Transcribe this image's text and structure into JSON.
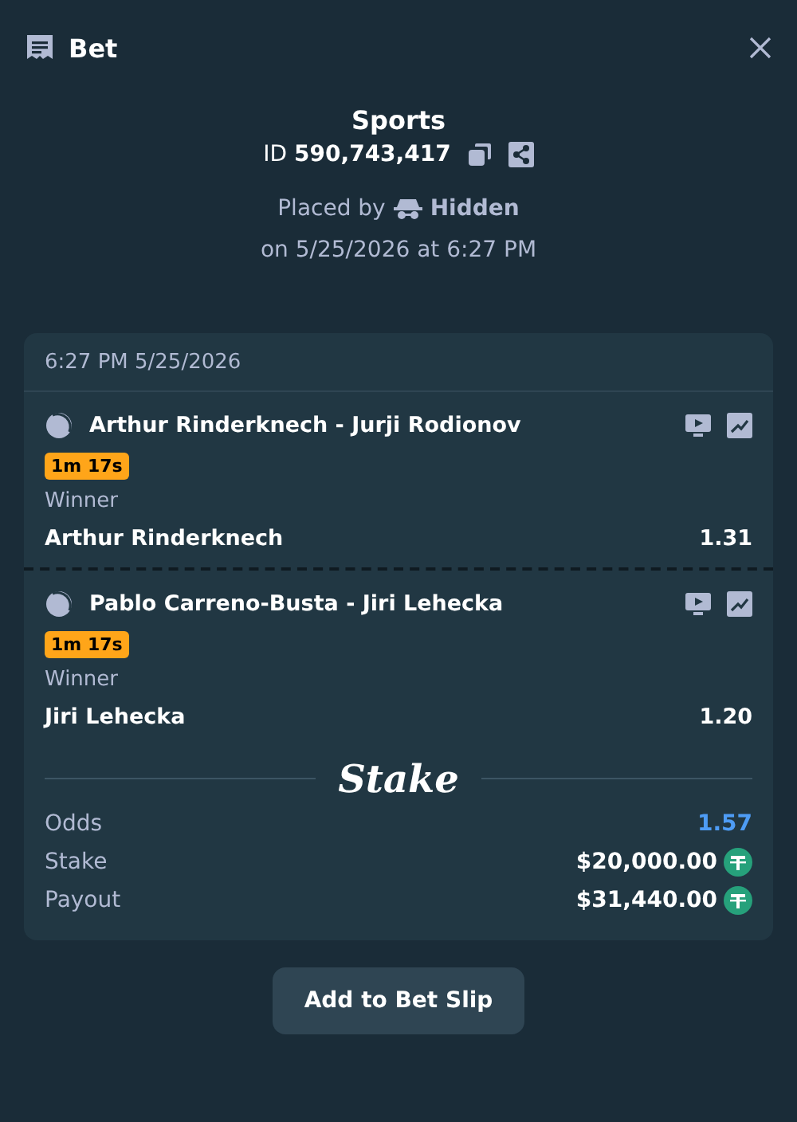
{
  "header": {
    "title": "Bet"
  },
  "bet": {
    "sport": "Sports",
    "id_label": "ID",
    "id": "590,743,417",
    "placed_by_label": "Placed by",
    "user": "Hidden",
    "placed_on": "on 5/25/2026 at 6:27 PM"
  },
  "slip": {
    "timestamp": "6:27 PM 5/25/2026",
    "legs": [
      {
        "event": "Arthur Rinderknech - Jurji Rodionov",
        "timer": "1m 17s",
        "market": "Winner",
        "selection": "Arthur Rinderknech",
        "odds": "1.31"
      },
      {
        "event": "Pablo Carreno-Busta - Jiri Lehecka",
        "timer": "1m 17s",
        "market": "Winner",
        "selection": "Jiri Lehecka",
        "odds": "1.20"
      }
    ],
    "brand": "Stake",
    "summary": [
      {
        "kind": "odds",
        "label": "Odds",
        "value": "1.57"
      },
      {
        "kind": "amount",
        "label": "Stake",
        "value": "$20,000.00"
      },
      {
        "kind": "amount",
        "label": "Payout",
        "value": "$31,440.00"
      }
    ]
  },
  "action": "Add to Bet Slip"
}
